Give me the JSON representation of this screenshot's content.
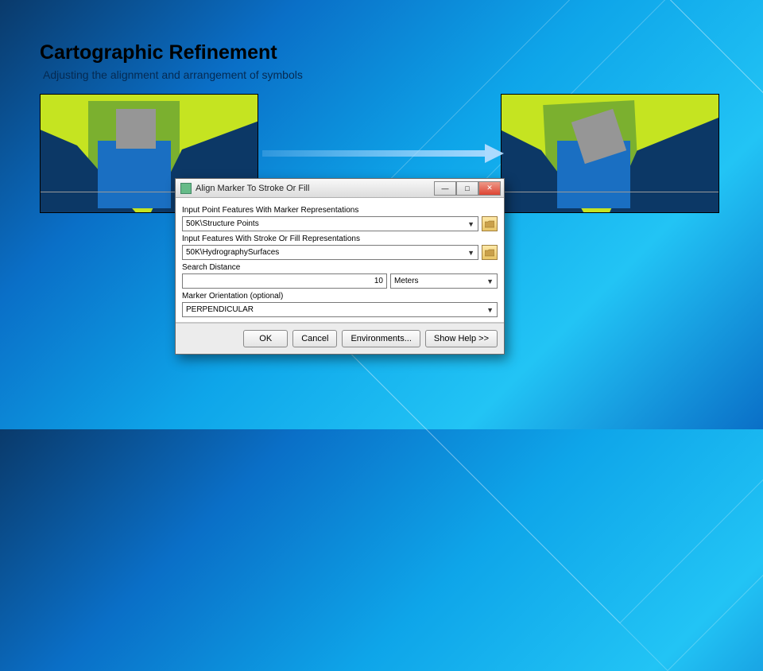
{
  "slide": {
    "title": "Cartographic Refinement",
    "subtitle": "Adjusting the alignment and arrangement of symbols"
  },
  "dialog": {
    "title": "Align Marker To Stroke Or Fill",
    "labels": {
      "input_points": "Input Point Features With Marker Representations",
      "input_fill": "Input Features With Stroke Or Fill Representations",
      "search_distance": "Search Distance",
      "marker_orientation": "Marker Orientation (optional)"
    },
    "values": {
      "input_points": "50K\\Structure Points",
      "input_fill": "50K\\HydrographySurfaces",
      "search_distance": "10",
      "search_unit": "Meters",
      "marker_orientation": "PERPENDICULAR"
    },
    "window_buttons": {
      "min": "—",
      "max": "□",
      "close": "✕"
    },
    "buttons": {
      "ok": "OK",
      "cancel": "Cancel",
      "environments": "Environments...",
      "show_help": "Show Help >>"
    }
  }
}
